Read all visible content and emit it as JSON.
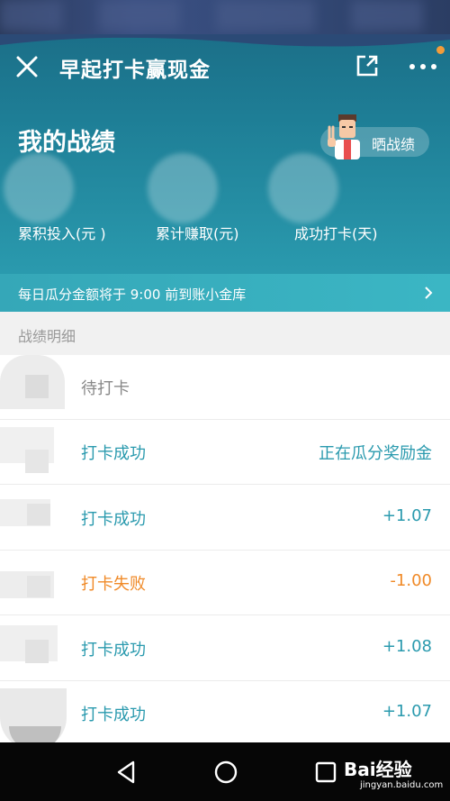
{
  "header": {
    "title": "早起打卡赢现金"
  },
  "stats": {
    "section_title": "我的战绩",
    "share_label": "晒战绩",
    "items": [
      {
        "label": "累积投入(元 )"
      },
      {
        "label": "累计赚取(元)"
      },
      {
        "label": "成功打卡(天)"
      }
    ]
  },
  "notice": {
    "text": "每日瓜分金额将于 9:00 前到账小金库"
  },
  "detail": {
    "header": "战绩明细",
    "rows": [
      {
        "status": "待打卡",
        "amount": ""
      },
      {
        "status": "打卡成功",
        "amount": "正在瓜分奖励金"
      },
      {
        "status": "打卡成功",
        "amount": "+1.07"
      },
      {
        "status": "打卡失败",
        "amount": "-1.00"
      },
      {
        "status": "打卡成功",
        "amount": "+1.08"
      },
      {
        "status": "打卡成功",
        "amount": "+1.07"
      }
    ]
  },
  "watermark": {
    "brand": "Bai经验",
    "url": "jingyan.baidu.com"
  },
  "colors": {
    "accent": "#2a9aae",
    "fail": "#f08a28",
    "notify_dot": "#f39c3a"
  },
  "icons": [
    "close-icon",
    "share-icon",
    "more-icon",
    "chevron-right-icon",
    "back-icon",
    "home-icon",
    "recent-apps-icon"
  ]
}
